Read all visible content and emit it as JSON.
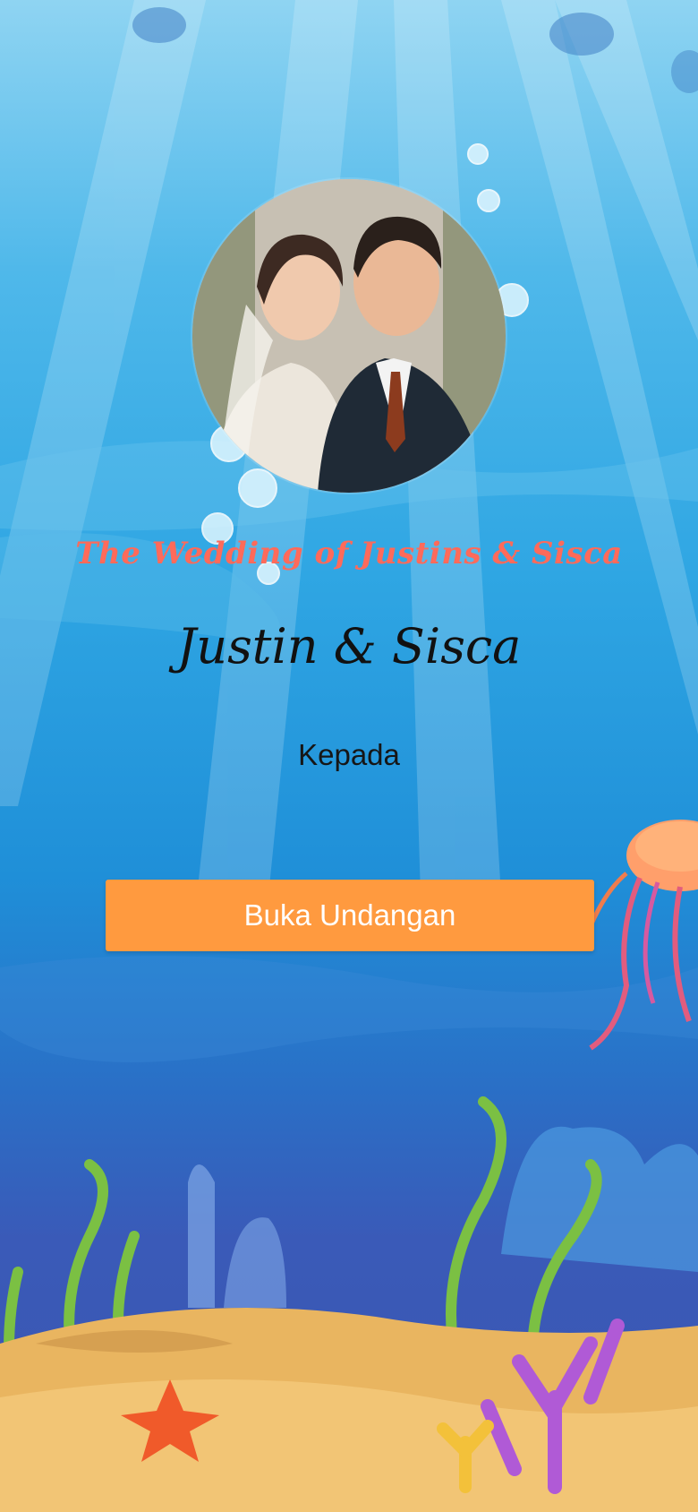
{
  "invitation": {
    "subtitle": "The Wedding of Justins & Sisca",
    "couple_names": "Justin & Sisca",
    "recipient_label": "Kepada",
    "open_button_label": "Buka Undangan"
  },
  "colors": {
    "subtitle": "#ff6a5a",
    "button": "#ff9a3f",
    "sand": "#e9b560"
  }
}
